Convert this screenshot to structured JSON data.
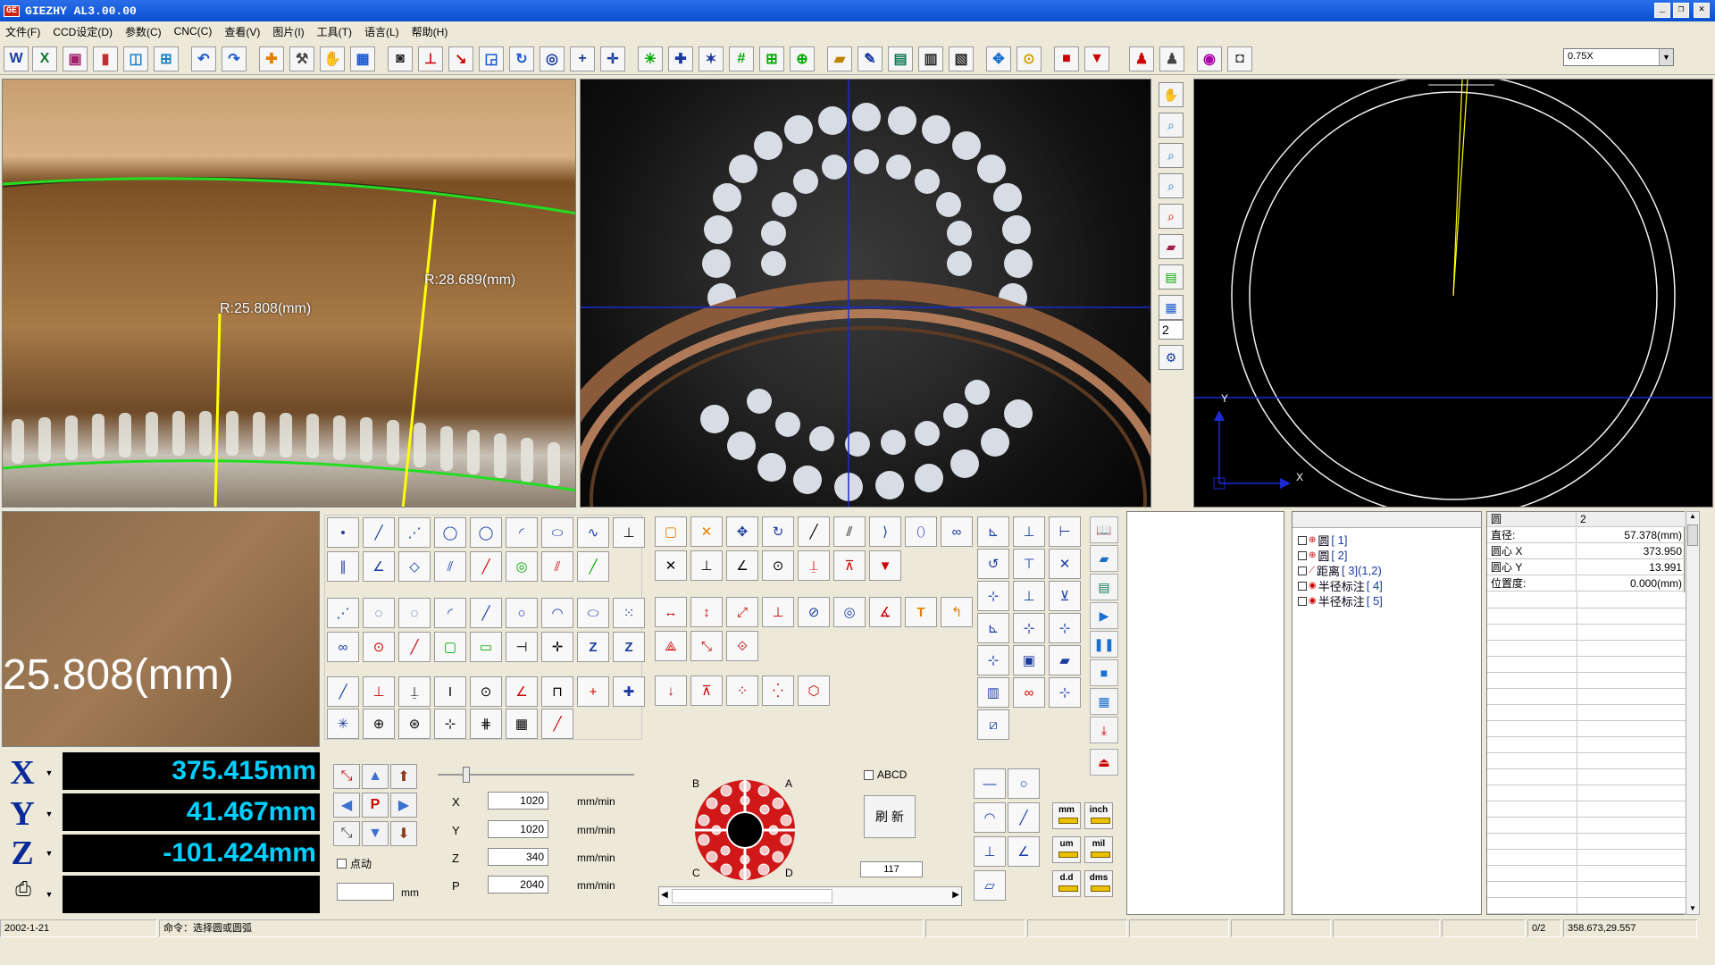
{
  "window": {
    "title": "GIEZHY AL3.00.00",
    "logo_text": "GE"
  },
  "menu": [
    "文件(F)",
    "CCD设定(D)",
    "参数(C)",
    "CNC(C)",
    "查看(V)",
    "图片(I)",
    "工具(T)",
    "语言(L)",
    "帮助(H)"
  ],
  "toolbar": {
    "zoom_value": "0.75X"
  },
  "camera1": {
    "measure_1": "R:25.808(mm)",
    "measure_2": "R:28.689(mm)"
  },
  "sidetools": {
    "field_value": "2"
  },
  "cad": {
    "axis_y": "Y",
    "axis_x": "X"
  },
  "zoomview": {
    "text": "25.808(mm)"
  },
  "dro": {
    "x_label": "X",
    "x_value": "375.415mm",
    "y_label": "Y",
    "y_value": "41.467mm",
    "z_label": "Z",
    "z_value": "-101.424mm"
  },
  "move": {
    "p_label": "P",
    "jog_label": "点动",
    "step_unit": "mm",
    "step_value": ""
  },
  "speeds": {
    "unit": "mm/min",
    "rows": [
      {
        "axis": "X",
        "value": "1020"
      },
      {
        "axis": "Y",
        "value": "1020"
      },
      {
        "axis": "Z",
        "value": "340"
      },
      {
        "axis": "P",
        "value": "2040"
      }
    ]
  },
  "light": {
    "label_a": "A",
    "label_b": "B",
    "label_c": "C",
    "label_d": "D",
    "abcd_label": "ABCD",
    "refresh_label": "刷 新",
    "intensity": "117"
  },
  "units": {
    "mm": "mm",
    "inch": "inch",
    "um": "um",
    "mil": "mil",
    "dd": "d.d",
    "dms": "dms"
  },
  "tree": {
    "items": [
      {
        "label": "圆",
        "id": "[ 1]"
      },
      {
        "label": "圆",
        "id": "[ 2]"
      },
      {
        "label": "距离",
        "id": "[ 3](1,2)"
      },
      {
        "label": "半径标注",
        "id": "[ 4]"
      },
      {
        "label": "半径标注",
        "id": "[ 5]"
      }
    ]
  },
  "props": {
    "rows": [
      {
        "k": "圆",
        "v": "2"
      },
      {
        "k": "直径:",
        "v": "57.378(mm)"
      },
      {
        "k": "圆心 X",
        "v": "373.950"
      },
      {
        "k": "圆心 Y",
        "v": "13.991"
      },
      {
        "k": "位置度:",
        "v": "0.000(mm)"
      }
    ]
  },
  "status": {
    "date": "2002-1-21",
    "command": "命令：选择圆或圆弧",
    "page": "0/2",
    "coords": "358.673,29.557"
  },
  "colors": {
    "measure_line": "#ffff00",
    "edge_green": "#22dd22",
    "crosshair": "#1a2ad0",
    "dro_text": "#00d0ff"
  }
}
